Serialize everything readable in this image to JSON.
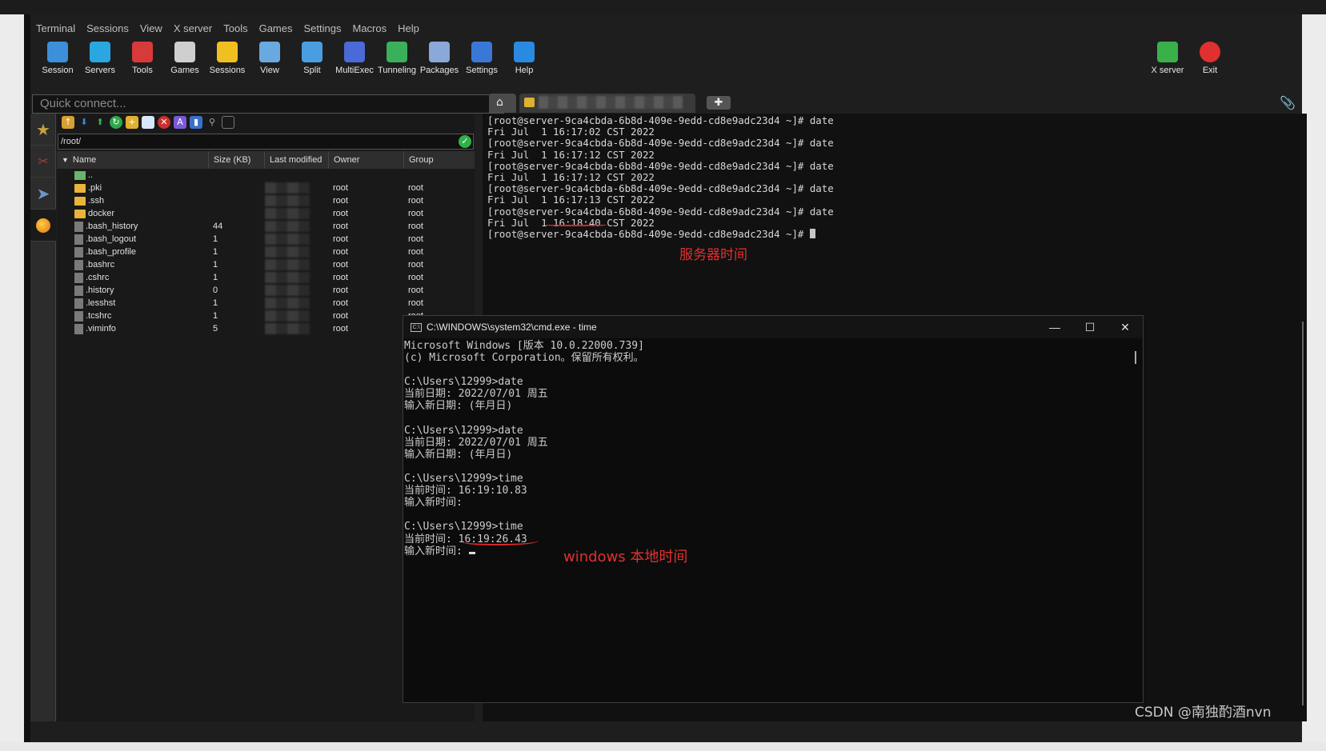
{
  "menu": [
    "Terminal",
    "Sessions",
    "View",
    "X server",
    "Tools",
    "Games",
    "Settings",
    "Macros",
    "Help"
  ],
  "toolbar": {
    "left": [
      {
        "label": "Session",
        "icon": "session-icon",
        "color": "#3c8fd8"
      },
      {
        "label": "Servers",
        "icon": "servers-icon",
        "color": "#2aa7e0"
      },
      {
        "label": "Tools",
        "icon": "tools-icon",
        "color": "#d83a3a"
      },
      {
        "label": "Games",
        "icon": "games-icon",
        "color": "#cfcfcf"
      },
      {
        "label": "Sessions",
        "icon": "star-icon",
        "color": "#f0c020"
      },
      {
        "label": "View",
        "icon": "view-icon",
        "color": "#6aa8e0"
      },
      {
        "label": "Split",
        "icon": "split-icon",
        "color": "#4a9ee0"
      },
      {
        "label": "MultiExec",
        "icon": "multiexec-icon",
        "color": "#4a6ad8"
      },
      {
        "label": "Tunneling",
        "icon": "tunneling-icon",
        "color": "#3ab05a"
      },
      {
        "label": "Packages",
        "icon": "packages-icon",
        "color": "#8aa8d8"
      },
      {
        "label": "Settings",
        "icon": "settings-icon",
        "color": "#3a78d8"
      },
      {
        "label": "Help",
        "icon": "help-icon",
        "color": "#2a8ae0"
      }
    ],
    "right": [
      {
        "label": "X server",
        "icon": "xserver-icon",
        "color": "#3ab04a"
      },
      {
        "label": "Exit",
        "icon": "power-icon",
        "color": "#e03030"
      }
    ]
  },
  "quick_connect": {
    "placeholder": "Quick connect..."
  },
  "sftp": {
    "path": "/root/",
    "columns": [
      "Name",
      "Size (KB)",
      "Last modified",
      "Owner",
      "Group"
    ],
    "rows": [
      {
        "name": "..",
        "type": "up",
        "size": "",
        "owner": "",
        "group": ""
      },
      {
        "name": ".pki",
        "type": "folder",
        "size": "",
        "owner": "root",
        "group": "root"
      },
      {
        "name": ".ssh",
        "type": "folder",
        "size": "",
        "owner": "root",
        "group": "root"
      },
      {
        "name": "docker",
        "type": "folder",
        "size": "",
        "owner": "root",
        "group": "root"
      },
      {
        "name": ".bash_history",
        "type": "file",
        "size": "44",
        "owner": "root",
        "group": "root"
      },
      {
        "name": ".bash_logout",
        "type": "file",
        "size": "1",
        "owner": "root",
        "group": "root"
      },
      {
        "name": ".bash_profile",
        "type": "file",
        "size": "1",
        "owner": "root",
        "group": "root"
      },
      {
        "name": ".bashrc",
        "type": "file",
        "size": "1",
        "owner": "root",
        "group": "root"
      },
      {
        "name": ".cshrc",
        "type": "file",
        "size": "1",
        "owner": "root",
        "group": "root"
      },
      {
        "name": ".history",
        "type": "file",
        "size": "0",
        "owner": "root",
        "group": "root"
      },
      {
        "name": ".lesshst",
        "type": "file",
        "size": "1",
        "owner": "root",
        "group": "root"
      },
      {
        "name": ".tcshrc",
        "type": "file",
        "size": "1",
        "owner": "root",
        "group": "root"
      },
      {
        "name": ".viminfo",
        "type": "file",
        "size": "5",
        "owner": "root",
        "group": "root"
      }
    ]
  },
  "terminal": {
    "lines": [
      "[root@server-9ca4cbda-6b8d-409e-9edd-cd8e9adc23d4 ~]# date",
      "Fri Jul  1 16:17:02 CST 2022",
      "[root@server-9ca4cbda-6b8d-409e-9edd-cd8e9adc23d4 ~]# date",
      "Fri Jul  1 16:17:12 CST 2022",
      "[root@server-9ca4cbda-6b8d-409e-9edd-cd8e9adc23d4 ~]# date",
      "Fri Jul  1 16:17:12 CST 2022",
      "[root@server-9ca4cbda-6b8d-409e-9edd-cd8e9adc23d4 ~]# date",
      "Fri Jul  1 16:17:13 CST 2022",
      "[root@server-9ca4cbda-6b8d-409e-9edd-cd8e9adc23d4 ~]# date",
      "Fri Jul  1 16:18:40 CST 2022",
      "[root@server-9ca4cbda-6b8d-409e-9edd-cd8e9adc23d4 ~]# "
    ],
    "annotation": "服务器时间"
  },
  "cmd": {
    "title": "C:\\WINDOWS\\system32\\cmd.exe - time",
    "lines": [
      "Microsoft Windows [版本 10.0.22000.739]",
      "(c) Microsoft Corporation。保留所有权利。",
      "",
      "C:\\Users\\12999>date",
      "当前日期: 2022/07/01 周五",
      "输入新日期: (年月日)",
      "",
      "C:\\Users\\12999>date",
      "当前日期: 2022/07/01 周五",
      "输入新日期: (年月日)",
      "",
      "C:\\Users\\12999>time",
      "当前时间: 16:19:10.83",
      "输入新时间:",
      "",
      "C:\\Users\\12999>time",
      "当前时间: 16:19:26.43",
      "输入新时间: "
    ],
    "annotation": "windows 本地时间"
  },
  "watermark": "CSDN @南独酌酒nvn"
}
